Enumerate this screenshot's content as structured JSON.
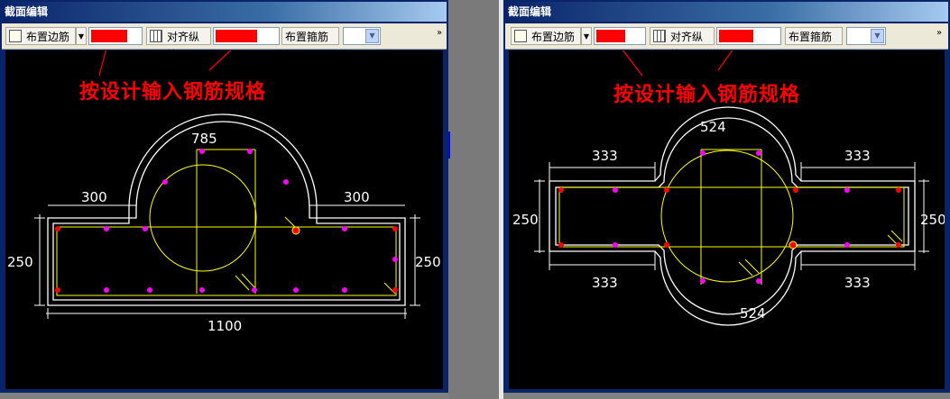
{
  "windows": [
    {
      "id": "left",
      "title": "截面编辑",
      "toolbar": {
        "edge_rebar_label": "布置边筋",
        "align_long_rebar_label": "对齐纵筋",
        "stirrup_label": "布置箍筋",
        "expand_glyph": "»"
      },
      "annotation": "按设计输入钢筋规格",
      "dimensions": {
        "arc": "785",
        "left_width": "300",
        "right_width": "300",
        "left_height": "250",
        "right_height": "250",
        "total_width": "1100"
      }
    },
    {
      "id": "right",
      "title": "截面编辑",
      "toolbar": {
        "edge_rebar_label": "布置边筋",
        "align_long_rebar_label": "对齐纵筋",
        "stirrup_label": "布置箍筋",
        "expand_glyph": "»"
      },
      "annotation": "按设计输入钢筋规格",
      "dimensions": {
        "arc_top": "524",
        "arc_bottom": "524",
        "top_left": "333",
        "top_right": "333",
        "bottom_left": "333",
        "bottom_right": "333",
        "left_height": "250",
        "right_height": "250"
      }
    }
  ],
  "colors": {
    "annotation": "#ff0000",
    "section_outline": "#ffffff",
    "stirrup": "#ffff00",
    "corner_bar": "#ff0000",
    "side_bar": "#ff00ff",
    "canvas_bg": "#000000",
    "window_frame": "#0a246a"
  }
}
